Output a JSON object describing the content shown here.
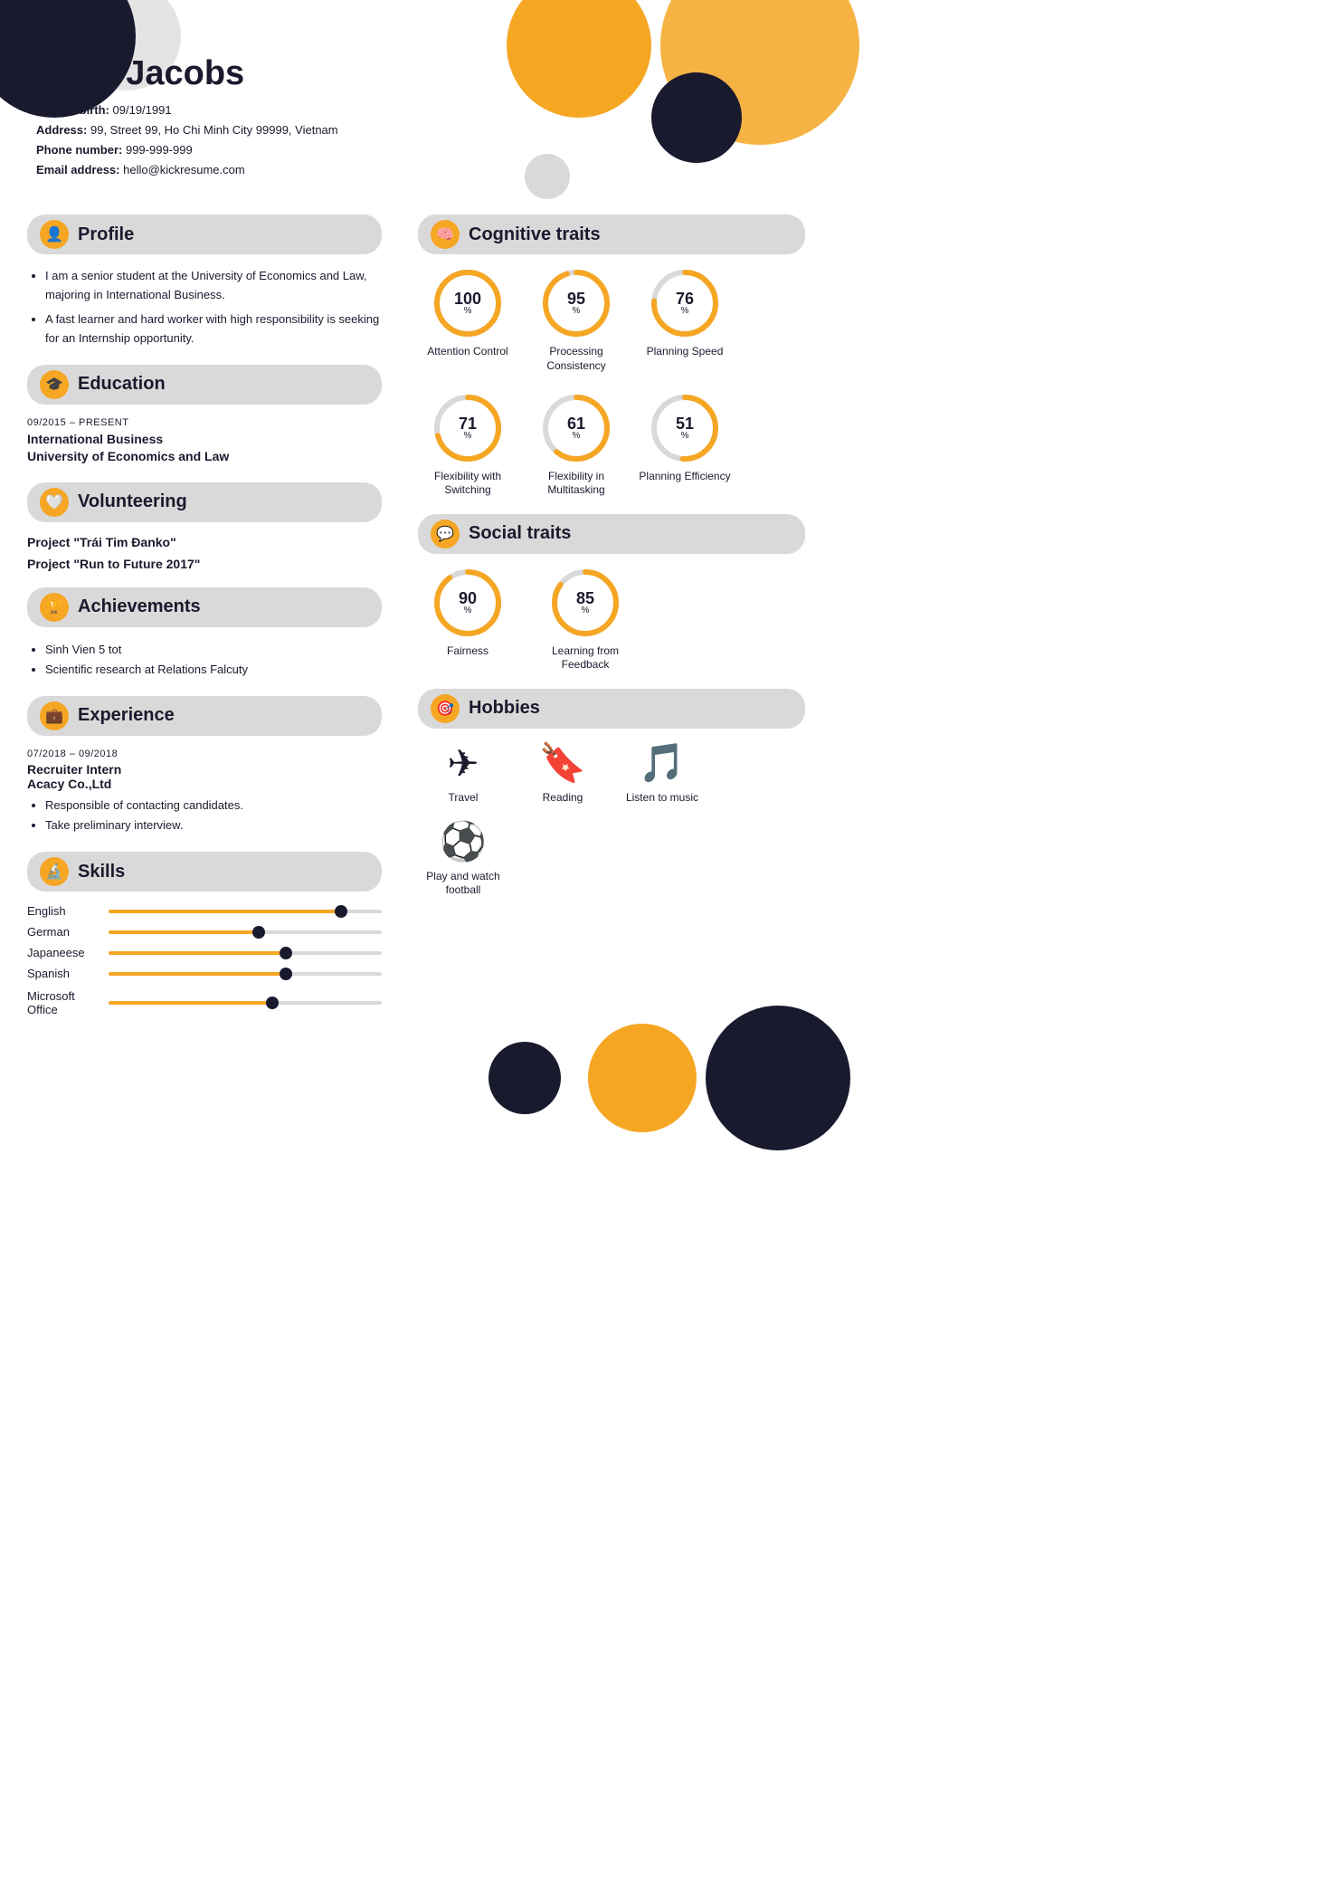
{
  "header": {
    "name": "Irwin Jacobs",
    "dob_label": "Date of birth:",
    "dob": "09/19/1991",
    "address_label": "Address:",
    "address": "99, Street 99, Ho Chi Minh City 99999, Vietnam",
    "phone_label": "Phone number:",
    "phone": "999-999-999",
    "email_label": "Email address:",
    "email": "hello@kickresume.com"
  },
  "profile": {
    "section_title": "Profile",
    "bullets": [
      "I am a senior student at the University of Economics and Law, majoring in International Business.",
      "A fast learner and hard worker with high responsibility is seeking for an Internship opportunity."
    ]
  },
  "education": {
    "section_title": "Education",
    "date": "09/2015 – PRESENT",
    "degree": "International Business",
    "school": "University of Economics and Law"
  },
  "volunteering": {
    "section_title": "Volunteering",
    "items": [
      "Project \"Trái Tim Đanko\"",
      "Project \"Run to Future 2017\""
    ]
  },
  "achievements": {
    "section_title": "Achievements",
    "items": [
      "Sinh Vien 5 tot",
      "Scientific research at Relations Falcuty"
    ]
  },
  "experience": {
    "section_title": "Experience",
    "date": "07/2018 – 09/2018",
    "title": "Recruiter Intern",
    "company": "Acacy Co.,Ltd",
    "bullets": [
      "Responsible of contacting candidates.",
      "Take preliminary interview."
    ]
  },
  "skills": {
    "section_title": "Skills",
    "languages": [
      {
        "name": "English",
        "pct": 85
      },
      {
        "name": "German",
        "pct": 55
      },
      {
        "name": "Japaneese",
        "pct": 65
      },
      {
        "name": "Spanish",
        "pct": 65
      }
    ],
    "tools": [
      {
        "name": "Microsoft Office",
        "pct": 60
      }
    ]
  },
  "cognitive_traits": {
    "section_title": "Cognitive traits",
    "items": [
      {
        "label": "Attention Control",
        "value": 100
      },
      {
        "label": "Processing Consistency",
        "value": 95
      },
      {
        "label": "Planning Speed",
        "value": 76
      },
      {
        "label": "Flexibility with Switching",
        "value": 71
      },
      {
        "label": "Flexibility in Multitasking",
        "value": 61
      },
      {
        "label": "Planning Efficiency",
        "value": 51
      }
    ]
  },
  "social_traits": {
    "section_title": "Social traits",
    "items": [
      {
        "label": "Fairness",
        "value": 90
      },
      {
        "label": "Learning from Feedback",
        "value": 85
      }
    ]
  },
  "hobbies": {
    "section_title": "Hobbies",
    "items": [
      {
        "label": "Travel",
        "icon": "✈"
      },
      {
        "label": "Reading",
        "icon": "🔖"
      },
      {
        "label": "Listen to music",
        "icon": "🎵"
      },
      {
        "label": "Play and watch football",
        "icon": "⚽"
      }
    ]
  },
  "colors": {
    "accent": "#f5a623",
    "dark": "#1a1a2e",
    "gray_bg": "#d9d9d9"
  }
}
